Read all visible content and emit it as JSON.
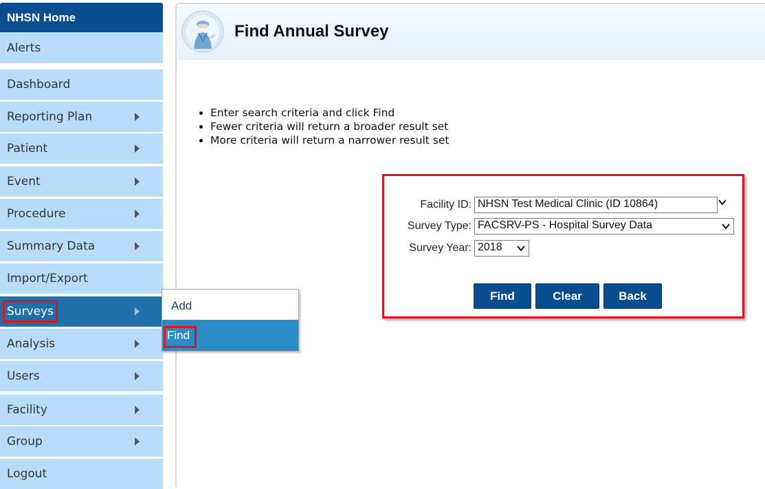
{
  "sidebar": {
    "home": "NHSN Home",
    "items": [
      {
        "label": "Alerts"
      },
      {
        "label": "Dashboard"
      },
      {
        "label": "Reporting Plan"
      },
      {
        "label": "Patient"
      },
      {
        "label": "Event"
      },
      {
        "label": "Procedure"
      },
      {
        "label": "Summary Data"
      },
      {
        "label": "Import/Export"
      },
      {
        "label": "Surveys"
      },
      {
        "label": "Analysis"
      },
      {
        "label": "Users"
      },
      {
        "label": "Facility"
      },
      {
        "label": "Group"
      },
      {
        "label": "Logout"
      }
    ]
  },
  "flyout": {
    "add": "Add",
    "find": "Find"
  },
  "page": {
    "title": "Find Annual Survey",
    "instructions": [
      "Enter search criteria and click Find",
      "Fewer criteria will return a broader result set",
      "More criteria will return a narrower result set"
    ]
  },
  "form": {
    "facility_label": "Facility ID:",
    "facility_value": "NHSN Test Medical Clinic (ID 10864)",
    "survey_type_label": "Survey Type:",
    "survey_type_value": "FACSRV-PS - Hospital Survey Data",
    "survey_year_label": "Survey Year:",
    "survey_year_value": "2018",
    "find": "Find",
    "clear": "Clear",
    "back": "Back"
  },
  "colors": {
    "nav_dark": "#0b4e8f",
    "nav_light": "#b9dcfb",
    "nav_active": "#1f70a8",
    "highlight": "#e0141e"
  }
}
